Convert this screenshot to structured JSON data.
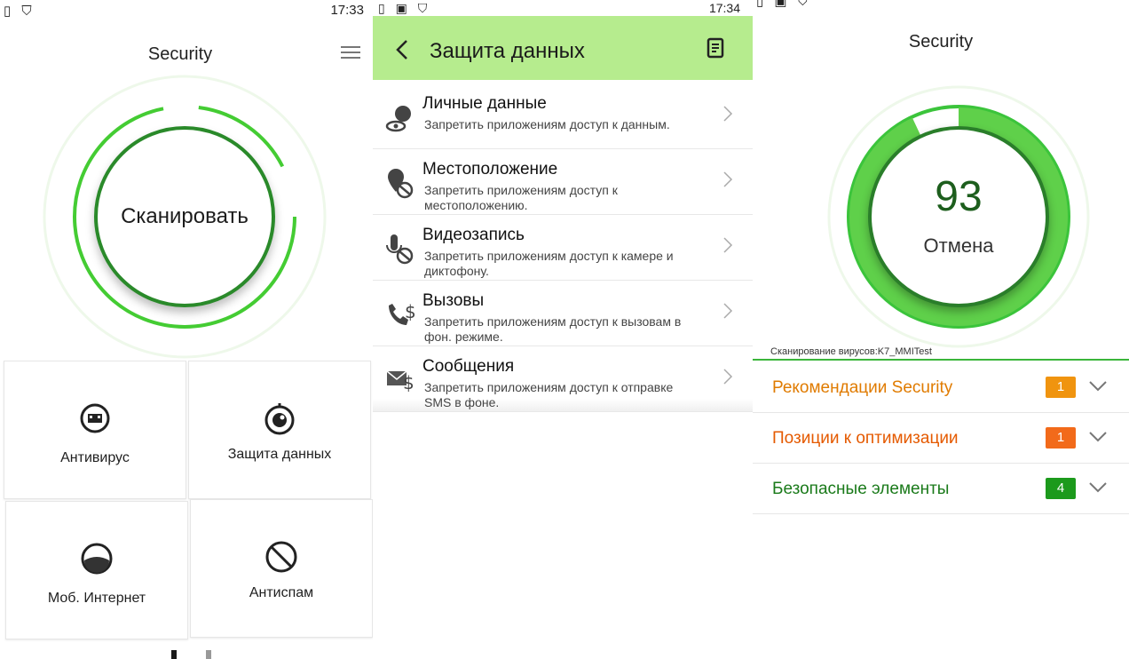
{
  "panel1": {
    "status": {
      "time": "17:33"
    },
    "title": "Security",
    "scan_label": "Сканировать",
    "tiles": [
      {
        "label": "Антивирус",
        "icon": "virus-icon"
      },
      {
        "label": "Защита данных",
        "icon": "privacy-eye-icon"
      },
      {
        "label": "Моб. Интернет",
        "icon": "mobile-data-icon"
      },
      {
        "label": "Антиспам",
        "icon": "block-icon"
      }
    ]
  },
  "panel2": {
    "status": {
      "time": "17:34"
    },
    "title": "Защита данных",
    "items": [
      {
        "title": "Личные данные",
        "desc": "Запретить приложениям доступ к данным.",
        "icon": "personal-data-icon"
      },
      {
        "title": "Местоположение",
        "desc": "Запретить приложениям доступ к местоположению.",
        "icon": "location-icon"
      },
      {
        "title": "Видеозапись",
        "desc": "Запретить приложениям доступ к камере и диктофону.",
        "icon": "microphone-icon"
      },
      {
        "title": "Вызовы",
        "desc": "Запретить приложениям доступ к вызовам в фон. режиме.",
        "icon": "call-icon"
      },
      {
        "title": "Сообщения",
        "desc": "Запретить приложениям доступ к отправке SMS в фоне.",
        "icon": "sms-icon"
      }
    ]
  },
  "panel3": {
    "title": "Security",
    "progress_value": "93",
    "cancel_label": "Отмена",
    "scan_status": "Сканирование вирусов:K7_MMITest",
    "results": [
      {
        "label": "Рекомендации Security",
        "count": "1",
        "label_color": "#e07b00",
        "badge_color": "#f0940f"
      },
      {
        "label": "Позиции к оптимизации",
        "count": "1",
        "label_color": "#e55a00",
        "badge_color": "#f26a1a"
      },
      {
        "label": "Безопасные элементы",
        "count": "4",
        "label_color": "#1a7a1a",
        "badge_color": "#1c9a1c"
      }
    ]
  },
  "colors": {
    "accent_green": "#3bc43b",
    "header_green": "#b6ec8e"
  }
}
